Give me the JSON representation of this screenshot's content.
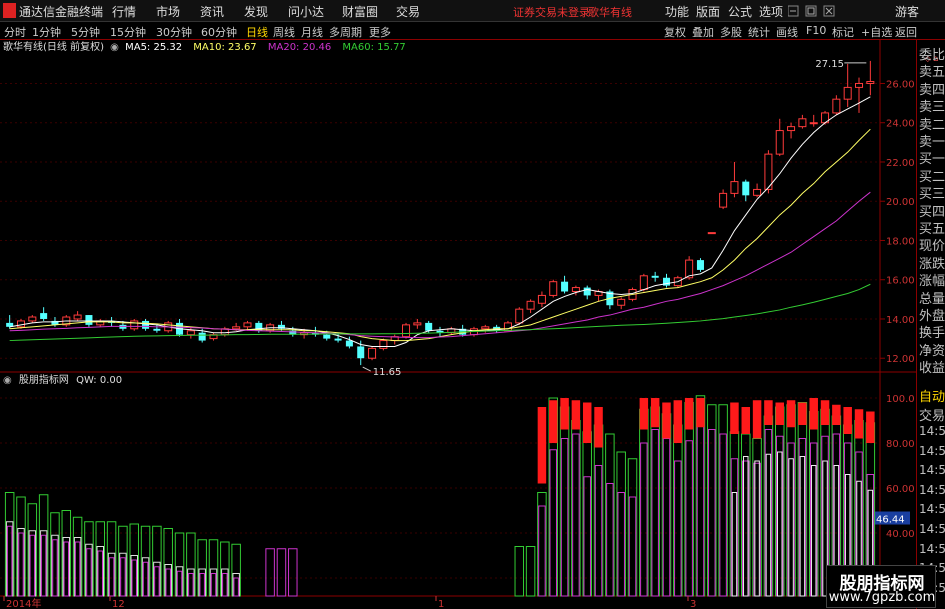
{
  "titlebar": {
    "app_title": "通达信金融终端",
    "menu": [
      "行情",
      "市场",
      "资讯",
      "发现",
      "问小达",
      "财富圈",
      "交易"
    ],
    "notice": "证券交易未登录",
    "security_name": "歌华有线",
    "right_menu": [
      "功能",
      "版面",
      "公式",
      "选项"
    ],
    "guest": "游客"
  },
  "tabs": {
    "periods": [
      "分时",
      "1分钟",
      "5分钟",
      "15分钟",
      "30分钟",
      "60分钟",
      "日线",
      "周线",
      "月线",
      "多周期",
      "更多"
    ],
    "active": "日线",
    "right_tools": [
      "复权",
      "叠加",
      "多股",
      "统计",
      "画线",
      "F10",
      "标记",
      "+自选",
      "返回"
    ]
  },
  "main_header": {
    "name": "歌华有线(日线 前复权)",
    "ma5": "MA5: 25.32",
    "ma10": "MA10: 23.67",
    "ma20": "MA20: 20.46",
    "ma60": "MA60: 15.77"
  },
  "annotations": {
    "high": "27.15",
    "low": "11.65"
  },
  "axis": {
    "price_ticks": [
      "26.00",
      "24.00",
      "22.00",
      "20.00",
      "18.00",
      "16.00",
      "14.00",
      "12.00"
    ],
    "ind_ticks": [
      "100.0",
      "80.00",
      "60.00",
      "40.00",
      "20.00"
    ],
    "ind_value": "46.44",
    "dates": [
      "2014年",
      "12",
      "1",
      "3"
    ]
  },
  "indicator_header": {
    "name": "股朋指标网",
    "qw": "QW: 0.00"
  },
  "side_labels": [
    "委比",
    "卖五",
    "卖四",
    "卖三",
    "卖二",
    "卖一",
    "买一",
    "买二",
    "买三",
    "买四",
    "买五",
    "现价",
    "涨跌",
    "涨幅",
    "总量",
    "外盘",
    "换手",
    "净资",
    "收益"
  ],
  "side_bottom": {
    "auto": "自动",
    "trade": "交易",
    "times": [
      "14:56",
      "14:56",
      "14:56",
      "14:56",
      "14:56",
      "14:56",
      "14:56",
      "14:56",
      "14:56"
    ]
  },
  "watermark": {
    "line1": "股朋指标网",
    "line2": "www.7gpzb.com"
  },
  "colors": {
    "up": "#ff3b3b",
    "down": "#54ffff",
    "ma5": "#ffffff",
    "ma10": "#ffff66",
    "ma20": "#cc33cc",
    "ma60": "#33cc33"
  },
  "chart_data": [
    {
      "type": "candlestick",
      "title": "歌华有线(日线 前复权)",
      "ylim": [
        11.4,
        27.4
      ],
      "candles": [
        [
          13.8,
          14.2,
          13.5,
          13.6
        ],
        [
          13.6,
          14.0,
          13.5,
          13.9
        ],
        [
          13.9,
          14.2,
          13.8,
          14.1
        ],
        [
          14.3,
          14.6,
          13.9,
          14.0
        ],
        [
          13.9,
          14.1,
          13.6,
          13.7
        ],
        [
          13.7,
          14.2,
          13.6,
          14.1
        ],
        [
          14.0,
          14.4,
          13.9,
          14.2
        ],
        [
          14.2,
          14.2,
          13.6,
          13.7
        ],
        [
          13.7,
          14.0,
          13.6,
          13.9
        ],
        [
          13.9,
          14.1,
          13.6,
          13.8
        ],
        [
          13.7,
          13.9,
          13.4,
          13.5
        ],
        [
          13.5,
          14.0,
          13.4,
          13.9
        ],
        [
          13.9,
          14.0,
          13.4,
          13.5
        ],
        [
          13.5,
          13.7,
          13.3,
          13.4
        ],
        [
          13.4,
          13.9,
          13.3,
          13.8
        ],
        [
          13.8,
          14.0,
          13.1,
          13.2
        ],
        [
          13.2,
          13.6,
          13.0,
          13.4
        ],
        [
          13.3,
          13.5,
          12.8,
          12.9
        ],
        [
          13.0,
          13.3,
          12.9,
          13.2
        ],
        [
          13.2,
          13.6,
          13.1,
          13.5
        ],
        [
          13.5,
          13.8,
          13.4,
          13.6
        ],
        [
          13.6,
          13.9,
          13.4,
          13.8
        ],
        [
          13.8,
          13.9,
          13.3,
          13.4
        ],
        [
          13.4,
          13.8,
          13.3,
          13.7
        ],
        [
          13.7,
          13.9,
          13.4,
          13.5
        ],
        [
          13.4,
          13.6,
          13.1,
          13.2
        ],
        [
          13.2,
          13.5,
          13.0,
          13.3
        ],
        [
          13.3,
          13.6,
          13.1,
          13.2
        ],
        [
          13.2,
          13.4,
          12.9,
          13.0
        ],
        [
          13.0,
          13.3,
          12.8,
          12.9
        ],
        [
          12.9,
          13.1,
          12.5,
          12.6
        ],
        [
          12.6,
          12.9,
          11.65,
          12.0
        ],
        [
          12.0,
          12.6,
          11.9,
          12.5
        ],
        [
          12.5,
          13.0,
          12.4,
          12.9
        ],
        [
          12.9,
          13.2,
          12.7,
          13.1
        ],
        [
          13.1,
          13.8,
          13.0,
          13.7
        ],
        [
          13.7,
          14.0,
          13.5,
          13.8
        ],
        [
          13.8,
          13.9,
          13.3,
          13.4
        ],
        [
          13.4,
          13.6,
          13.1,
          13.3
        ],
        [
          13.3,
          13.6,
          13.2,
          13.5
        ],
        [
          13.5,
          13.7,
          13.1,
          13.2
        ],
        [
          13.2,
          13.6,
          13.1,
          13.5
        ],
        [
          13.5,
          13.7,
          13.3,
          13.6
        ],
        [
          13.6,
          13.7,
          13.3,
          13.4
        ],
        [
          13.4,
          13.9,
          13.4,
          13.8
        ],
        [
          13.8,
          14.6,
          13.7,
          14.5
        ],
        [
          14.5,
          15.0,
          14.3,
          14.9
        ],
        [
          14.8,
          15.4,
          14.6,
          15.2
        ],
        [
          15.2,
          16.0,
          15.1,
          15.9
        ],
        [
          15.9,
          16.2,
          15.3,
          15.4
        ],
        [
          15.4,
          15.7,
          15.2,
          15.6
        ],
        [
          15.6,
          15.7,
          15.0,
          15.2
        ],
        [
          15.2,
          15.5,
          14.9,
          15.4
        ],
        [
          15.4,
          15.5,
          14.5,
          14.7
        ],
        [
          14.7,
          15.1,
          14.5,
          15.0
        ],
        [
          15.0,
          15.6,
          14.9,
          15.5
        ],
        [
          15.5,
          16.3,
          15.4,
          16.2
        ],
        [
          16.2,
          16.4,
          15.9,
          16.1
        ],
        [
          16.1,
          16.3,
          15.6,
          15.7
        ],
        [
          15.7,
          16.2,
          15.6,
          16.1
        ],
        [
          16.1,
          17.2,
          16.0,
          17.0
        ],
        [
          17.0,
          17.1,
          16.4,
          16.5
        ],
        [
          18.4,
          18.4,
          18.4,
          18.4
        ],
        [
          19.7,
          20.6,
          19.6,
          20.4
        ],
        [
          20.4,
          22.0,
          20.2,
          21.0
        ],
        [
          21.0,
          21.1,
          20.0,
          20.3
        ],
        [
          20.3,
          20.9,
          20.2,
          20.6
        ],
        [
          20.6,
          22.6,
          20.4,
          22.4
        ],
        [
          22.4,
          24.2,
          22.3,
          23.6
        ],
        [
          23.6,
          24.0,
          23.2,
          23.8
        ],
        [
          23.8,
          24.4,
          23.7,
          24.2
        ],
        [
          24.0,
          24.4,
          23.8,
          24.0
        ],
        [
          24.0,
          24.6,
          23.9,
          24.5
        ],
        [
          24.5,
          25.4,
          24.4,
          25.2
        ],
        [
          25.2,
          27.0,
          24.8,
          25.8
        ],
        [
          25.8,
          26.3,
          24.5,
          26.0
        ],
        [
          26.0,
          27.15,
          25.4,
          26.1
        ]
      ],
      "ma": {
        "MA5": [
          13.6,
          13.7,
          13.8,
          13.85,
          13.85,
          13.9,
          13.9,
          13.9,
          13.9,
          13.9,
          13.85,
          13.8,
          13.75,
          13.7,
          13.6,
          13.5,
          13.45,
          13.4,
          13.3,
          13.3,
          13.35,
          13.45,
          13.5,
          13.55,
          13.55,
          13.5,
          13.45,
          13.4,
          13.3,
          13.15,
          12.95,
          12.7,
          12.6,
          12.6,
          12.6,
          12.8,
          13.2,
          13.4,
          13.45,
          13.5,
          13.45,
          13.4,
          13.4,
          13.45,
          13.5,
          13.75,
          14.1,
          14.5,
          14.9,
          15.15,
          15.35,
          15.5,
          15.4,
          15.3,
          15.25,
          15.3,
          15.5,
          15.7,
          15.8,
          15.9,
          16.2,
          16.3,
          16.6,
          17.5,
          18.5,
          19.3,
          20.1,
          20.7,
          21.4,
          22.2,
          22.9,
          23.5,
          24.0,
          24.4,
          24.7,
          25.0,
          25.32
        ],
        "MA10": [
          13.5,
          13.55,
          13.6,
          13.65,
          13.7,
          13.75,
          13.8,
          13.85,
          13.85,
          13.85,
          13.8,
          13.8,
          13.78,
          13.75,
          13.7,
          13.65,
          13.6,
          13.55,
          13.5,
          13.48,
          13.45,
          13.45,
          13.45,
          13.45,
          13.45,
          13.45,
          13.4,
          13.4,
          13.35,
          13.3,
          13.25,
          13.1,
          13.0,
          12.95,
          12.9,
          12.9,
          12.95,
          13.0,
          13.1,
          13.2,
          13.3,
          13.4,
          13.45,
          13.5,
          13.5,
          13.6,
          13.7,
          13.9,
          14.1,
          14.3,
          14.5,
          14.7,
          14.9,
          15.05,
          15.15,
          15.25,
          15.35,
          15.45,
          15.55,
          15.6,
          15.75,
          15.9,
          16.1,
          16.5,
          17.0,
          17.6,
          18.1,
          18.7,
          19.3,
          19.8,
          20.4,
          20.9,
          21.5,
          22.0,
          22.5,
          23.1,
          23.67
        ],
        "MA20": [
          13.4,
          13.42,
          13.45,
          13.48,
          13.5,
          13.52,
          13.55,
          13.57,
          13.6,
          13.62,
          13.62,
          13.62,
          13.62,
          13.6,
          13.6,
          13.58,
          13.56,
          13.54,
          13.5,
          13.48,
          13.45,
          13.42,
          13.4,
          13.38,
          13.36,
          13.34,
          13.32,
          13.3,
          13.28,
          13.25,
          13.2,
          13.15,
          13.12,
          13.1,
          13.08,
          13.06,
          13.05,
          13.05,
          13.08,
          13.1,
          13.15,
          13.2,
          13.25,
          13.3,
          13.35,
          13.4,
          13.45,
          13.55,
          13.65,
          13.75,
          13.85,
          13.95,
          14.1,
          14.2,
          14.35,
          14.5,
          14.6,
          14.75,
          14.9,
          15.0,
          15.15,
          15.3,
          15.5,
          15.7,
          15.95,
          16.2,
          16.5,
          16.8,
          17.1,
          17.4,
          17.8,
          18.2,
          18.6,
          19.0,
          19.5,
          20.0,
          20.46
        ],
        "MA60": [
          12.9,
          12.92,
          12.94,
          12.96,
          12.98,
          13.0,
          13.02,
          13.04,
          13.06,
          13.08,
          13.1,
          13.12,
          13.13,
          13.14,
          13.15,
          13.16,
          13.17,
          13.18,
          13.18,
          13.19,
          13.2,
          13.2,
          13.21,
          13.22,
          13.22,
          13.22,
          13.23,
          13.23,
          13.24,
          13.24,
          13.24,
          13.24,
          13.24,
          13.25,
          13.25,
          13.26,
          13.27,
          13.28,
          13.3,
          13.32,
          13.34,
          13.36,
          13.38,
          13.4,
          13.42,
          13.44,
          13.46,
          13.48,
          13.5,
          13.53,
          13.56,
          13.59,
          13.62,
          13.65,
          13.68,
          13.7,
          13.72,
          13.75,
          13.78,
          13.82,
          13.86,
          13.9,
          13.96,
          14.02,
          14.1,
          14.18,
          14.26,
          14.36,
          14.46,
          14.6,
          14.72,
          14.85,
          15.0,
          15.15,
          15.3,
          15.5,
          15.77
        ]
      }
    },
    {
      "type": "bar",
      "title": "股朋指标网",
      "ylim": [
        12,
        104
      ],
      "series": [
        {
          "name": "white",
          "values": [
            45,
            42,
            41,
            41,
            39,
            38,
            38,
            35,
            34,
            31,
            31,
            30,
            29,
            27,
            26,
            25,
            24,
            24,
            24,
            24,
            22,
            0,
            0,
            0,
            0,
            0,
            0,
            0,
            0,
            0,
            0,
            0,
            0,
            0,
            0,
            0,
            0,
            0,
            0,
            0,
            0,
            0,
            0,
            0,
            0,
            0,
            0,
            0,
            0,
            0,
            0,
            0,
            0,
            0,
            0,
            0,
            0,
            0,
            0,
            0,
            0,
            0,
            0,
            0,
            0,
            0,
            0,
            0,
            0,
            0,
            0,
            0,
            0,
            0,
            0,
            0,
            0
          ]
        },
        {
          "name": "green",
          "values": [
            58,
            56,
            53,
            57,
            49,
            50,
            47,
            45,
            45,
            45,
            43,
            44,
            43,
            43,
            42,
            40,
            40,
            37,
            37,
            36,
            35,
            0,
            0,
            0,
            0,
            0,
            0,
            0,
            0,
            0,
            0,
            0,
            0,
            0,
            0,
            0,
            0,
            0,
            0,
            0,
            0,
            0,
            0,
            0,
            0,
            0,
            0,
            0,
            0,
            0,
            0,
            0,
            0,
            0,
            0,
            0,
            0,
            0,
            0,
            0,
            0,
            0,
            0,
            0,
            0,
            0,
            0,
            0,
            0,
            0,
            0,
            0,
            0,
            0,
            0,
            0,
            0
          ]
        },
        {
          "name": "red",
          "values": [
            0,
            0,
            0,
            0,
            0,
            0,
            0,
            0,
            0,
            0,
            0,
            0,
            0,
            0,
            0,
            0,
            0,
            0,
            0,
            0,
            0,
            0,
            0,
            0,
            0,
            0,
            0,
            0,
            0,
            0,
            0,
            0,
            0,
            0,
            0,
            0,
            0,
            0,
            0,
            0,
            0,
            0,
            0,
            0,
            0,
            0,
            95,
            96,
            95,
            92,
            90,
            88,
            89,
            0,
            0,
            0,
            0,
            0,
            0,
            0,
            0,
            0,
            0,
            0,
            0,
            0,
            0,
            0,
            0,
            0,
            0,
            0,
            0,
            0,
            0,
            0,
            0
          ]
        }
      ]
    }
  ]
}
